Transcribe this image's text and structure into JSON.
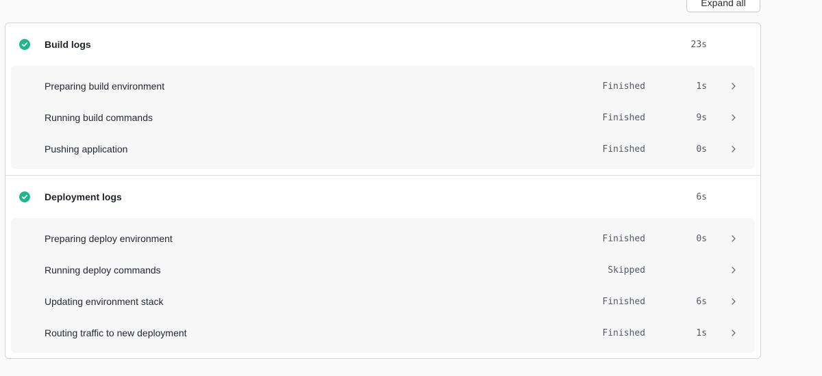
{
  "toolbar": {
    "expand_label": "Expand all"
  },
  "colors": {
    "success": "#1fb58f"
  },
  "build": {
    "title": "Build logs",
    "duration": "23s",
    "icon": "check-circle-icon",
    "steps": [
      {
        "label": "Preparing build environment",
        "status": "Finished",
        "duration": "1s"
      },
      {
        "label": "Running build commands",
        "status": "Finished",
        "duration": "9s"
      },
      {
        "label": "Pushing application",
        "status": "Finished",
        "duration": "0s"
      }
    ]
  },
  "deploy": {
    "title": "Deployment logs",
    "duration": "6s",
    "icon": "check-circle-icon",
    "steps": [
      {
        "label": "Preparing deploy environment",
        "status": "Finished",
        "duration": "0s"
      },
      {
        "label": "Running deploy commands",
        "status": "Skipped",
        "duration": ""
      },
      {
        "label": "Updating environment stack",
        "status": "Finished",
        "duration": "6s"
      },
      {
        "label": "Routing traffic to new deployment",
        "status": "Finished",
        "duration": "1s"
      }
    ]
  }
}
